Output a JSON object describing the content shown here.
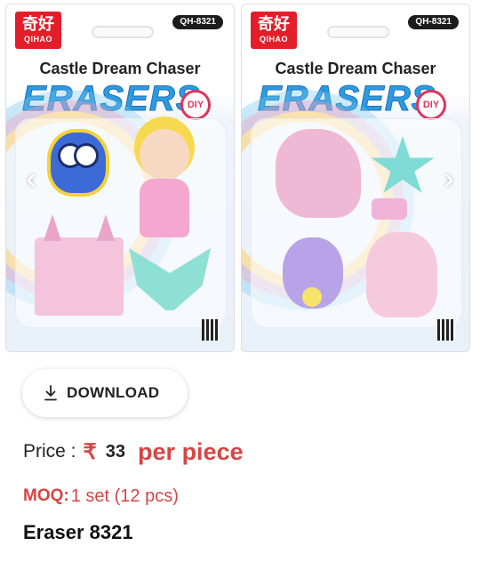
{
  "gallery": {
    "prev_icon": "chevron-left-icon",
    "next_icon": "chevron-right-icon",
    "images": [
      {
        "brand_zh": "奇好",
        "brand_en": "QIHAO",
        "code": "QH-8321",
        "title": "Castle Dream Chaser",
        "big_text": "ERASERS",
        "badge": "DIY"
      },
      {
        "brand_zh": "奇好",
        "brand_en": "QIHAO",
        "code": "QH-8321",
        "title": "Castle Dream Chaser",
        "big_text": "ERASERS",
        "badge": "DIY"
      }
    ]
  },
  "download": {
    "label": "DOWNLOAD",
    "icon": "download-icon"
  },
  "price": {
    "label": "Price :",
    "currency": "₹",
    "amount": "33",
    "unit": "per piece"
  },
  "moq": {
    "label": "MOQ:",
    "value": "1 set (12 pcs)"
  },
  "product": {
    "name": "Eraser 8321"
  },
  "colors": {
    "accent": "#d64545",
    "brand_red": "#e31d2a",
    "title_blue": "#2b9be2"
  }
}
